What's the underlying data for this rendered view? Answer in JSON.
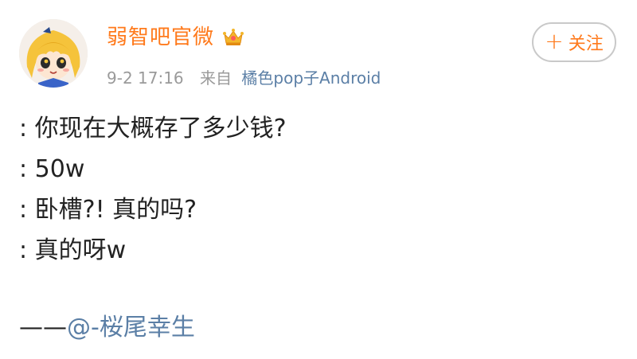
{
  "post": {
    "author": {
      "name": "弱智吧官微",
      "avatar_icon": "cartoon-girl-avatar-icon",
      "badge_icon": "vip-crown-icon"
    },
    "meta": {
      "time": "9-2 17:16",
      "from_label": "来自",
      "source": "橘色pop子Android"
    },
    "follow_button": {
      "label": "关注",
      "icon": "plus-icon"
    },
    "lines": [
      ": 你现在大概存了多少钱?",
      ": 50w",
      ": 卧槽?! 真的吗?",
      ": 真的呀w"
    ],
    "signature": {
      "dash": "——",
      "mention": "@-桜尾幸生"
    }
  },
  "colors": {
    "accent_orange": "#ff7a1c",
    "link_blue": "#5b7fa6",
    "meta_gray": "#9a9a9a"
  }
}
